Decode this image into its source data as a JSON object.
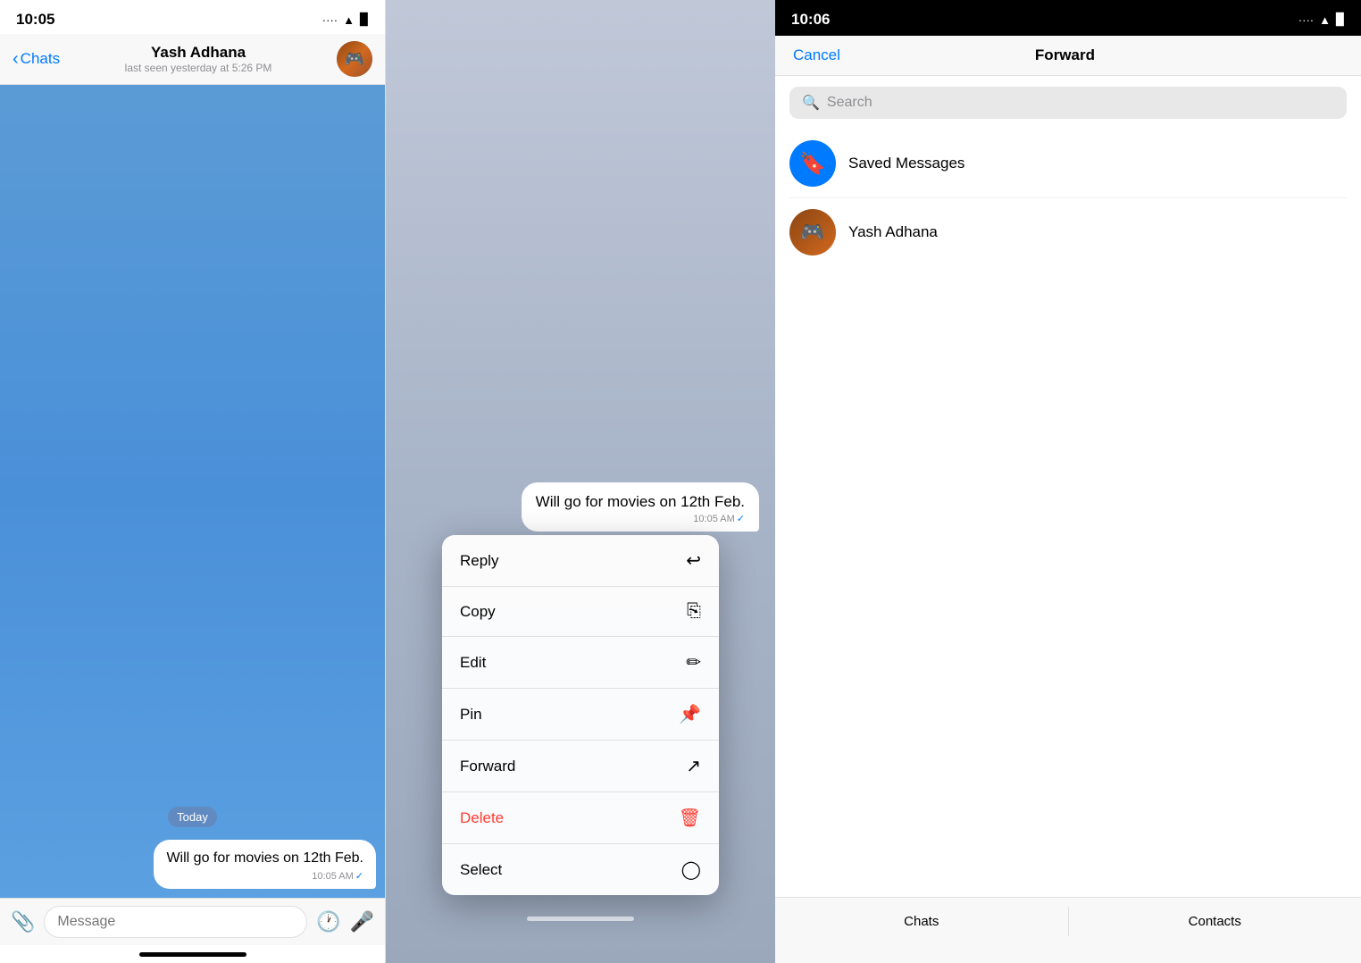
{
  "panel1": {
    "statusBar": {
      "time": "10:05",
      "signal": "···· ",
      "wifi": "▲",
      "battery": "▓"
    },
    "header": {
      "backLabel": "Chats",
      "name": "Yash Adhana",
      "status": "last seen yesterday at 5:26 PM"
    },
    "chatBody": {
      "dateLabel": "Today",
      "message": {
        "text": "Will go for movies on 12th Feb.",
        "time": "10:05 AM",
        "check": "✓"
      }
    },
    "inputBar": {
      "placeholder": "Message"
    }
  },
  "panel2": {
    "message": {
      "text": "Will go for movies on 12th Feb.",
      "time": "10:05 AM",
      "check": "✓"
    },
    "menuItems": [
      {
        "label": "Reply",
        "icon": "↩",
        "delete": false
      },
      {
        "label": "Copy",
        "icon": "⎘",
        "delete": false
      },
      {
        "label": "Edit",
        "icon": "✏",
        "delete": false
      },
      {
        "label": "Pin",
        "icon": "📌",
        "delete": false
      },
      {
        "label": "Forward",
        "icon": "↗",
        "delete": false
      },
      {
        "label": "Delete",
        "icon": "🗑",
        "delete": true
      },
      {
        "label": "Select",
        "icon": "◯",
        "delete": false
      }
    ]
  },
  "panel3": {
    "statusBar": {
      "time": "10:06",
      "signal": "···· ",
      "wifi": "▲",
      "battery": "▓"
    },
    "nav": {
      "cancelLabel": "Cancel",
      "title": "Forward"
    },
    "search": {
      "placeholder": "Search"
    },
    "contacts": [
      {
        "type": "saved",
        "name": "Saved Messages"
      },
      {
        "type": "contact",
        "name": "Yash Adhana"
      }
    ],
    "bottomTabs": [
      {
        "label": "Chats"
      },
      {
        "label": "Contacts"
      }
    ]
  }
}
